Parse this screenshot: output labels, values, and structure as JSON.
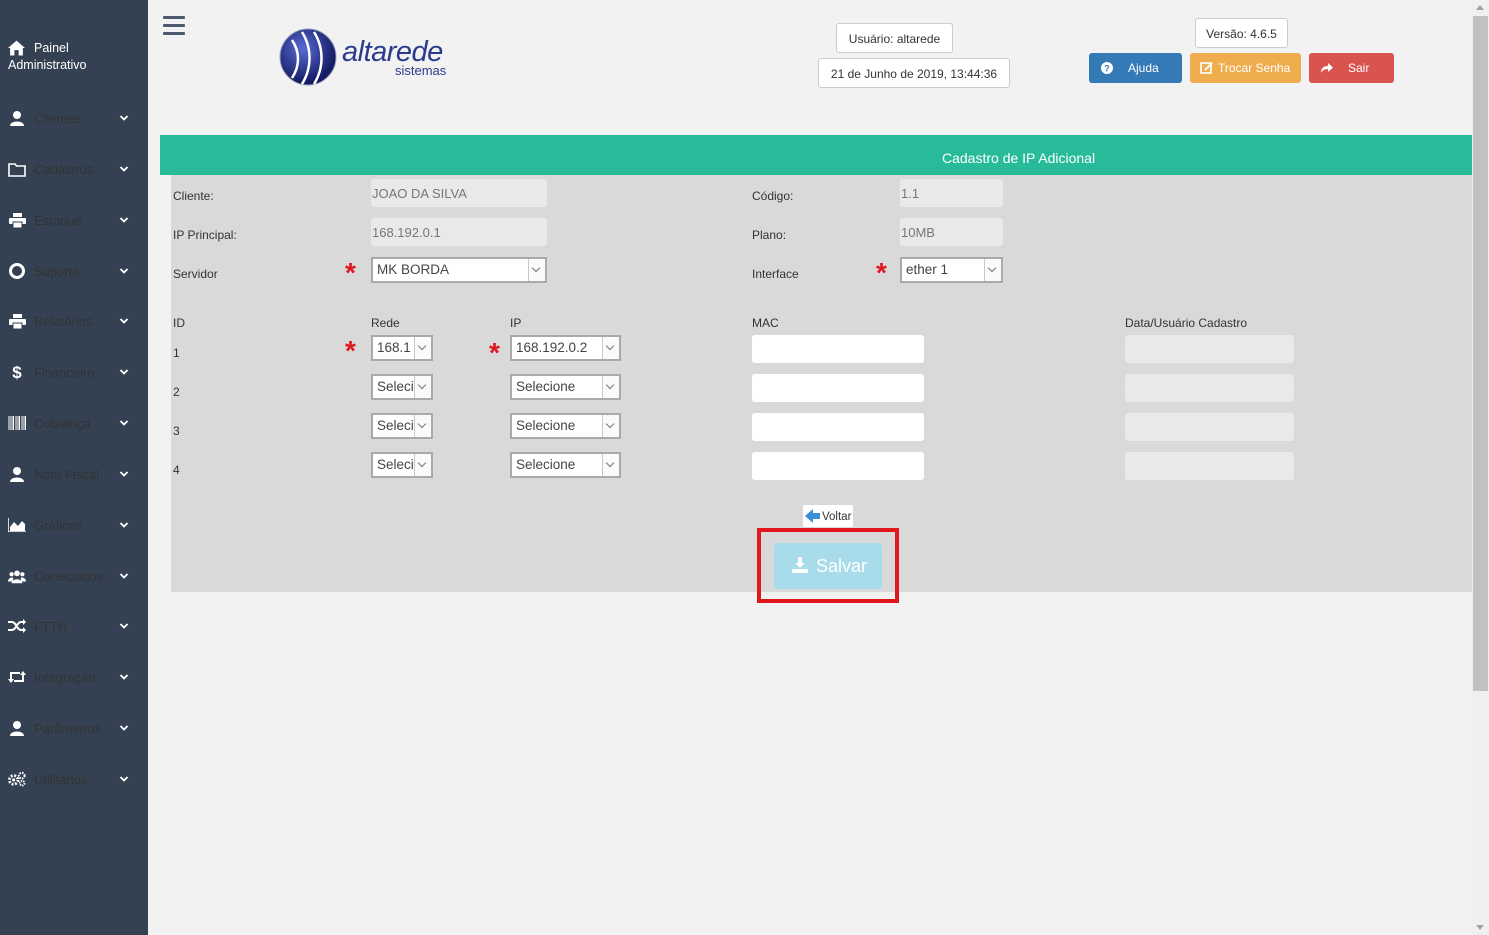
{
  "sidebar": {
    "top_label_line1": "Painel",
    "top_label_line2": "Administrativo",
    "items": [
      {
        "label": "Clientes",
        "icon": "user-icon"
      },
      {
        "label": "Cadastros",
        "icon": "folder-icon"
      },
      {
        "label": "Estoque",
        "icon": "printer-icon"
      },
      {
        "label": "Suporte",
        "icon": "lifebuoy-icon"
      },
      {
        "label": "Relatórios",
        "icon": "printer-icon"
      },
      {
        "label": "Financeiro",
        "icon": "dollar-icon"
      },
      {
        "label": "Cobrança",
        "icon": "barcode-icon"
      },
      {
        "label": "Nota Fiscal",
        "icon": "user-icon"
      },
      {
        "label": "Gráficos",
        "icon": "area-chart-icon"
      },
      {
        "label": "Conectados",
        "icon": "users-icon"
      },
      {
        "label": "FTTH",
        "icon": "random-icon"
      },
      {
        "label": "Integraçao",
        "icon": "retweet-icon"
      },
      {
        "label": "Parâmetros",
        "icon": "user-icon"
      },
      {
        "label": "Utilitários",
        "icon": "cogs-icon"
      }
    ]
  },
  "header": {
    "logo_name": "altarede",
    "logo_sub": "sistemas",
    "user": "Usuário: altarede",
    "datetime": "21 de Junho de 2019, 13:44:36",
    "version": "Versão: 4.6.5",
    "help_label": "Ajuda",
    "change_password_label": "Trocar Senha",
    "logout_label": "Sair",
    "colors": {
      "help": "#337ab7",
      "change_password": "#f0ad4e",
      "logout": "#d9534f"
    }
  },
  "form": {
    "title": "Cadastro de IP Adicional",
    "cliente_label": "Cliente:",
    "cliente_value": "JOAO DA SILVA",
    "codigo_label": "Código:",
    "codigo_value": "1.1",
    "ip_principal_label": "IP Principal:",
    "ip_principal_value": "168.192.0.1",
    "plano_label": "Plano:",
    "plano_value": "10MB",
    "servidor_label": "Servidor",
    "servidor_value": "MK BORDA",
    "interface_label": "Interface",
    "interface_value": "ether 1",
    "columns": {
      "id": "ID",
      "rede": "Rede",
      "ip": "IP",
      "mac": "MAC",
      "data": "Data/Usuário Cadastro"
    },
    "rows": [
      {
        "id": "1",
        "rede": "168.1",
        "ip": "168.192.0.2",
        "mac": "",
        "data": ""
      },
      {
        "id": "2",
        "rede": "Selecione",
        "ip": "Selecione",
        "mac": "",
        "data": ""
      },
      {
        "id": "3",
        "rede": "Selecione",
        "ip": "Selecione",
        "mac": "",
        "data": ""
      },
      {
        "id": "4",
        "rede": "Selecione",
        "ip": "Selecione",
        "mac": "",
        "data": ""
      }
    ],
    "voltar_label": "Voltar",
    "salvar_label": "Salvar"
  }
}
